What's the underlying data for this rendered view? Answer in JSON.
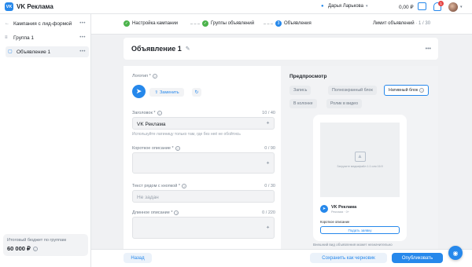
{
  "app": {
    "title": "VK Реклама",
    "logo_letter": "VK"
  },
  "header": {
    "user_name": "Дарья Ларькова",
    "balance": "0,00 ₽",
    "notifications": "1"
  },
  "sidebar": {
    "items": [
      {
        "label": "Кампания с лид-формой",
        "icon": "back-arrow-icon"
      },
      {
        "label": "Группа 1",
        "icon": "group-icon"
      },
      {
        "label": "Объявление 1",
        "icon": "ad-icon"
      }
    ],
    "budget_label": "Итоговый бюджет по группам",
    "budget_value": "60 000 ₽"
  },
  "steps": [
    {
      "label": "Настройка кампании",
      "state": "done"
    },
    {
      "label": "Группы объявлений",
      "state": "done"
    },
    {
      "label": "Объявления",
      "state": "current",
      "number": "3"
    }
  ],
  "limit": {
    "label": "Лимит объявлений",
    "value": "1 / 30"
  },
  "ad": {
    "title": "Объявление 1"
  },
  "form": {
    "logo_label": "Логотип *",
    "replace_label": "Заменить",
    "headline_label": "Заголовок *",
    "headline_count": "10 / 40",
    "headline_value": "VK Реклама",
    "headline_hint": "Используйте латиницу только там, где без неё не обойтись",
    "short_desc_label": "Короткое описание *",
    "short_desc_count": "0 / 90",
    "button_text_label": "Текст рядом с кнопкой *",
    "button_text_count": "0 / 30",
    "button_text_placeholder": "Не задан",
    "long_desc_label": "Длинное описание *",
    "long_desc_count": "0 / 220"
  },
  "preview": {
    "title": "Предпросмотр",
    "chips": [
      "Запись",
      "Полноэкранный блок",
      "Нативный блок",
      "В колонке",
      "Ролик в видео"
    ],
    "selected_chip": "Нативный блок",
    "image_placeholder": "Загрузите медиафайл 1:1 или 16:9",
    "ad_name": "VK Реклама",
    "ad_sub": "Реклама · 0+",
    "ad_desc": "Короткое описание",
    "ad_button": "Подать заявку",
    "note": "Внешний вид объявления может незначительно"
  },
  "footer": {
    "back": "Назад",
    "save_draft": "Сохранить как черновик",
    "publish": "Опубликовать"
  },
  "colors": {
    "accent": "#2688eb",
    "success": "#4bb34b",
    "danger": "#e64646"
  }
}
